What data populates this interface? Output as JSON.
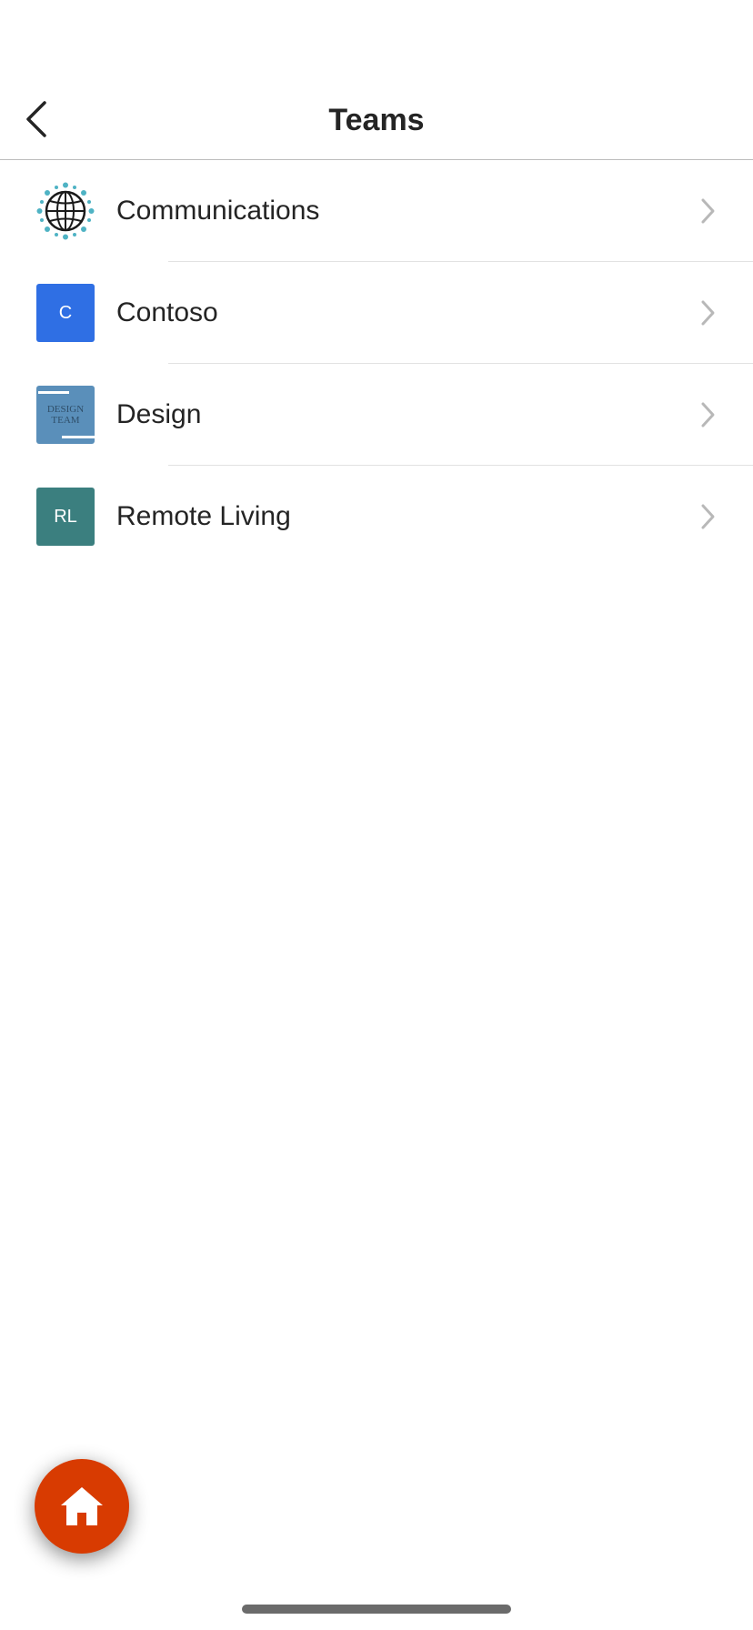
{
  "header": {
    "title": "Teams",
    "back_icon": "chevron-left-icon"
  },
  "teams": [
    {
      "name": "Communications",
      "avatar_type": "globe-image",
      "avatar_text": "",
      "avatar_color": "#4fb3c4"
    },
    {
      "name": "Contoso",
      "avatar_type": "initials",
      "avatar_text": "C",
      "avatar_color": "#2f6fe4"
    },
    {
      "name": "Design",
      "avatar_type": "image",
      "avatar_text": "DESIGN TEAM",
      "avatar_color": "#5a8fba"
    },
    {
      "name": "Remote Living",
      "avatar_type": "initials",
      "avatar_text": "RL",
      "avatar_color": "#3b7f7f"
    }
  ],
  "fab": {
    "icon": "home-icon",
    "color": "#d83b01"
  }
}
